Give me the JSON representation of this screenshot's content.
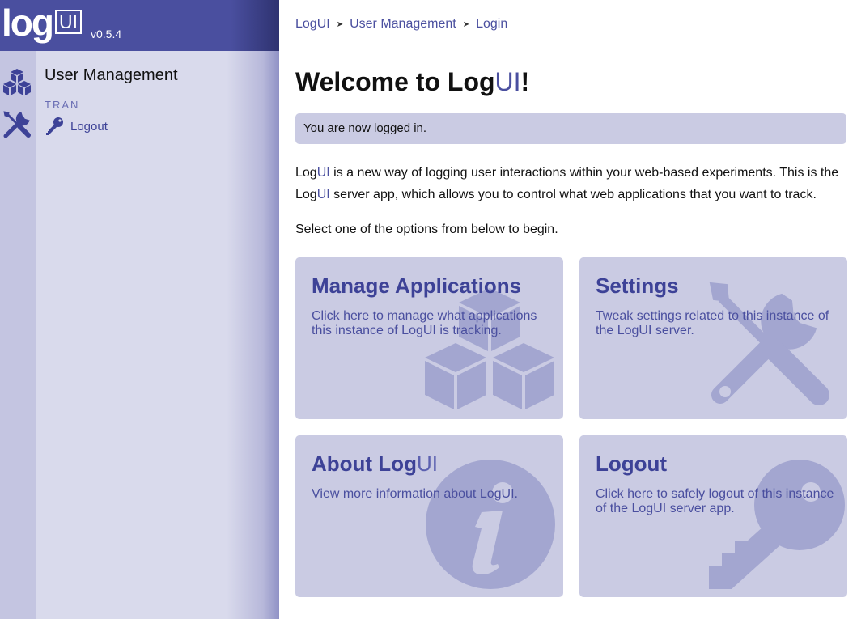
{
  "sidebar": {
    "logo": {
      "log": "log",
      "ui": "UI"
    },
    "version": "v0.5.4",
    "rail": [
      {
        "icon": "cubes-icon"
      },
      {
        "icon": "tools-icon"
      }
    ],
    "title": "User Management",
    "username": "TRAN",
    "logout_label": "Logout"
  },
  "breadcrumb": [
    "LogUI",
    "User Management",
    "Login"
  ],
  "main": {
    "title_prefix": "Welcome to Log",
    "title_ui": "UI",
    "title_suffix": "!",
    "alert": "You are now logged in.",
    "intro": {
      "log1": "Log",
      "ui1": "UI",
      "text1": " is a new way of logging user interactions within your web-based experiments. This is the ",
      "log2": "Log",
      "ui2": "UI",
      "text2": " server app, which allows you to control what web applications that you want to track."
    },
    "select_text": "Select one of the options from below to begin."
  },
  "cards": {
    "apps": {
      "title": "Manage Applications",
      "text": "Click here to manage what applications this instance of LogUI is tracking.",
      "icon": "cubes-icon"
    },
    "settings": {
      "title": "Settings",
      "text": "Tweak settings related to this instance of the LogUI server.",
      "icon": "tools-icon"
    },
    "about": {
      "title_log": "About Log",
      "title_ui": "UI",
      "text": "View more information about LogUI.",
      "icon": "info-icon"
    },
    "logout": {
      "title": "Logout",
      "text": "Click here to safely logout of this instance of the LogUI server app.",
      "icon": "key-icon"
    }
  },
  "colors": {
    "brand": "#4a4f9f",
    "sidebar": "#d9daec",
    "card": "#cacbe3",
    "card_icon": "#a3a6d0"
  }
}
